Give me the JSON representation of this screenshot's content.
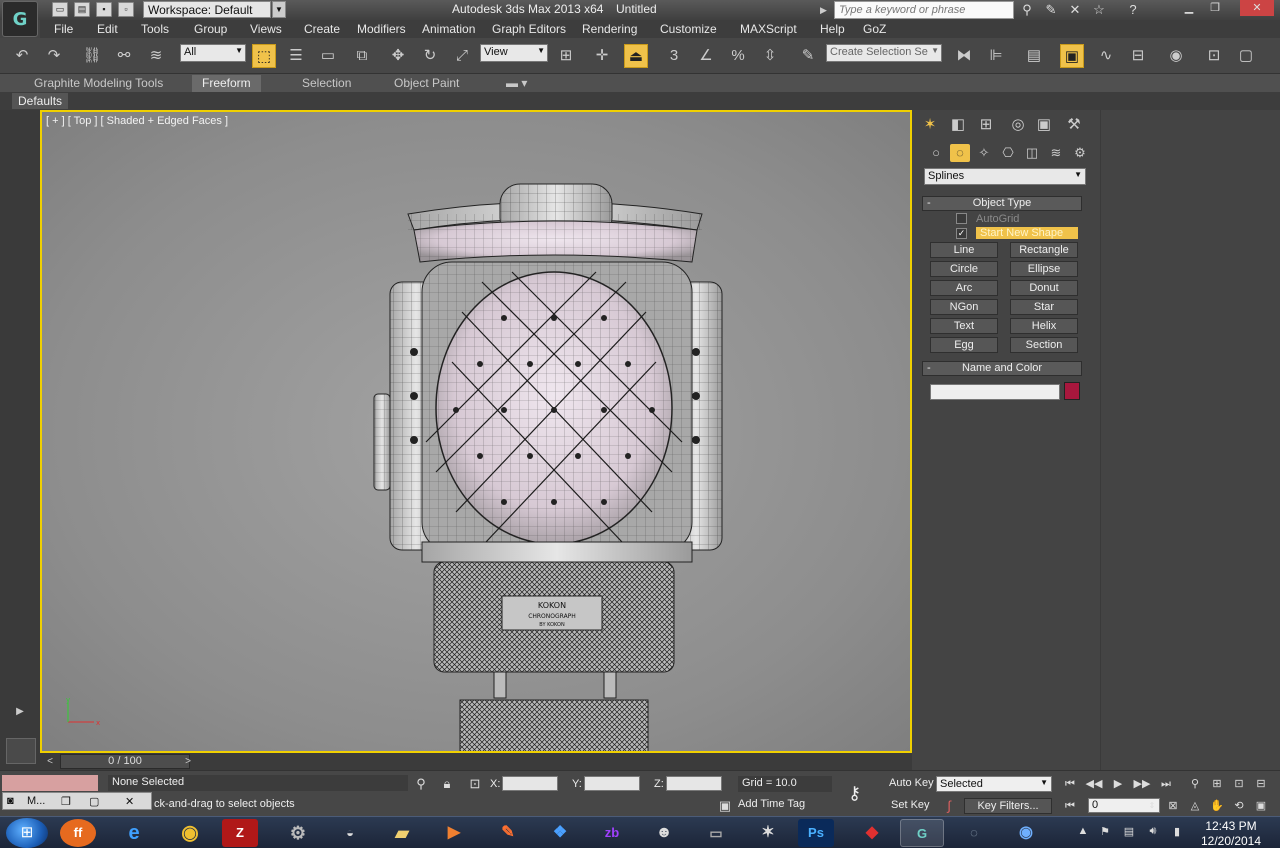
{
  "titlebar": {
    "workspace": "Workspace: Default",
    "app_title": "Autodesk 3ds Max  2013 x64",
    "doc_title": "Untitled",
    "search_placeholder": "Type a keyword or phrase"
  },
  "menu": [
    "File",
    "Edit",
    "Tools",
    "Group",
    "Views",
    "Create",
    "Modifiers",
    "Animation",
    "Graph Editors",
    "Rendering",
    "Customize",
    "MAXScript",
    "Help",
    "GoZ"
  ],
  "toolbar": {
    "selection_filter": "All",
    "ref_coord": "View",
    "named_selection_placeholder": "Create Selection Se"
  },
  "ribbon": {
    "tabs": [
      "Graphite Modeling Tools",
      "Freeform",
      "Selection",
      "Object Paint"
    ],
    "active_tab": "Freeform",
    "defaults": "Defaults"
  },
  "viewport": {
    "label": "[ + ] [ Top ] [ Shaded + Edged Faces ]",
    "engraving_lines": [
      "KOKON",
      "CHRONOGRAPH",
      "BY KOKON"
    ],
    "axis_x": "x",
    "axis_y": "y"
  },
  "command_panel": {
    "category_dropdown": "Splines",
    "object_type_header": "Object Type",
    "autogrid_label": "AutoGrid",
    "start_new_shape_label": "Start New Shape",
    "start_new_shape_checked": true,
    "buttons": [
      "Line",
      "Rectangle",
      "Circle",
      "Ellipse",
      "Arc",
      "Donut",
      "NGon",
      "Star",
      "Text",
      "Helix",
      "Egg",
      "Section"
    ],
    "name_color_header": "Name and Color",
    "name_value": "",
    "color": "#a8173d"
  },
  "timeline": {
    "frame_label": "0 / 100"
  },
  "status": {
    "selection": "None Selected",
    "prompt": "ck-and-drag to select objects",
    "x_label": "X:",
    "y_label": "Y:",
    "z_label": "Z:",
    "grid": "Grid = 10.0",
    "add_time_tag": "Add Time Tag",
    "auto_key": "Auto Key",
    "set_key": "Set Key",
    "selected_dropdown": "Selected",
    "key_filters": "Key Filters...",
    "current_frame": "0"
  },
  "mini_task": {
    "label": "M..."
  },
  "taskbar": {
    "time": "12:43 PM",
    "date": "12/20/2014"
  }
}
